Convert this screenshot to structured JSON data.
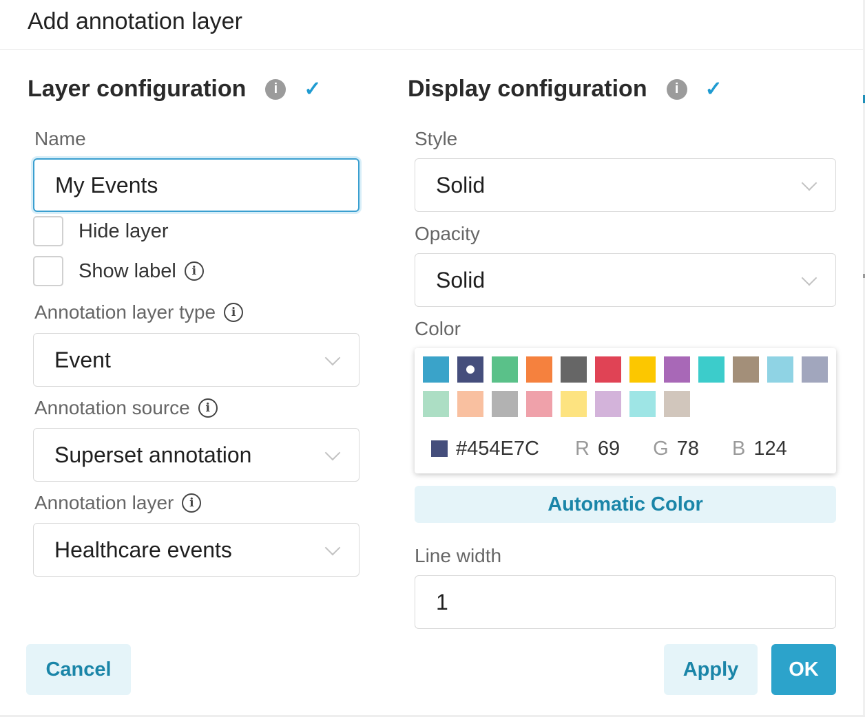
{
  "dialog": {
    "title": "Add annotation layer"
  },
  "layer_config": {
    "title": "Layer configuration",
    "name_label": "Name",
    "name_value": "My Events",
    "hide_layer_label": "Hide layer",
    "hide_layer_checked": false,
    "show_label_label": "Show label",
    "show_label_checked": false,
    "type_label": "Annotation layer type",
    "type_value": "Event",
    "source_label": "Annotation source",
    "source_value": "Superset annotation",
    "layer_label": "Annotation layer",
    "layer_value": "Healthcare events"
  },
  "display_config": {
    "title": "Display configuration",
    "style_label": "Style",
    "style_value": "Solid",
    "opacity_label": "Opacity",
    "opacity_value": "Solid",
    "color_label": "Color",
    "line_width_label": "Line width",
    "line_width_value": "1"
  },
  "color_picker": {
    "swatches": [
      "#3aa3c9",
      "#454e7c",
      "#5ac189",
      "#f5813e",
      "#666666",
      "#e04355",
      "#fcc700",
      "#a868b7",
      "#3ccccb",
      "#a38f79",
      "#8fd3e4",
      "#a1a6bd",
      "#acdec4",
      "#f9c0a0",
      "#b2b2b2",
      "#efa1aa",
      "#fde380",
      "#d3b3da",
      "#9ee5e5",
      "#d1c6bc"
    ],
    "selected_color": "#454e7c",
    "hex": "#454E7C",
    "r_label": "R",
    "r": "69",
    "g_label": "G",
    "g": "78",
    "b_label": "B",
    "b": "124"
  },
  "icons": {
    "info": "i",
    "check": "✓"
  },
  "buttons": {
    "automatic_color": "Automatic Color",
    "cancel": "Cancel",
    "apply": "Apply",
    "ok": "OK"
  }
}
